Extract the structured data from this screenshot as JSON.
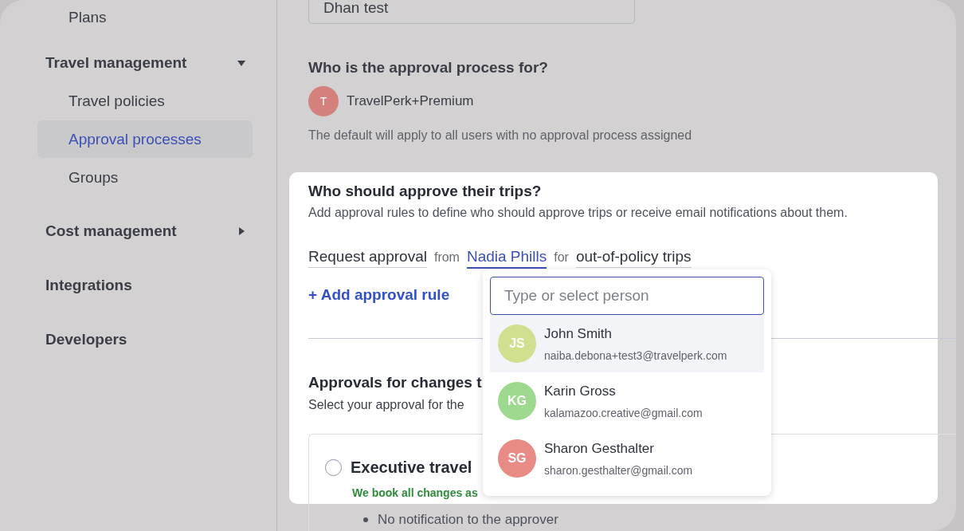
{
  "sidebar": {
    "loose_items": [
      {
        "label": "Plans",
        "selected": false
      }
    ],
    "groups": [
      {
        "label": "Travel management",
        "expanded": true,
        "children": [
          {
            "label": "Travel policies",
            "selected": false
          },
          {
            "label": "Approval processes",
            "selected": true
          },
          {
            "label": "Groups",
            "selected": false
          }
        ]
      },
      {
        "label": "Cost management",
        "expanded": false
      },
      {
        "label": "Integrations"
      },
      {
        "label": "Developers"
      }
    ]
  },
  "name_field": {
    "value": "Dhan test"
  },
  "audience": {
    "title": "Who is the approval process for?",
    "member": {
      "initial": "T",
      "name": "TravelPerk+Premium",
      "color": "#d4807c"
    },
    "note": "The default will apply to all users with no approval process assigned"
  },
  "approvers": {
    "title": "Who should approve their trips?",
    "description": "Add approval rules to define who should approve trips or receive email notifications about them.",
    "rule": [
      {
        "kind": "select",
        "text": "Request approval",
        "selected": false
      },
      {
        "kind": "word",
        "text": "from"
      },
      {
        "kind": "select",
        "text": "Nadia Phills",
        "selected": true
      },
      {
        "kind": "word",
        "text": "for"
      },
      {
        "kind": "select",
        "text": "out-of-policy trips",
        "selected": false
      }
    ],
    "add_link": "+ Add approval rule"
  },
  "changes": {
    "title": "Approvals for changes t",
    "description": "Select your approval for the",
    "option": {
      "label": "Executive travel",
      "checked": false,
      "tagline": "We book all changes as",
      "bullet": "No notification to the approver"
    }
  },
  "person_dropdown": {
    "placeholder": "Type or select person",
    "options": [
      {
        "initials": "JS",
        "name": "John Smith",
        "email": "naiba.debona+test3@travelperk.com",
        "color": "#cfe08f",
        "selected": true
      },
      {
        "initials": "KG",
        "name": "Karin Gross",
        "email": "kalamazoo.creative@gmail.com",
        "color": "#9dd98e",
        "selected": false
      },
      {
        "initials": "SG",
        "name": "Sharon Gesthalter",
        "email": "sharon.gesthalter@gmail.com",
        "color": "#e88b84",
        "selected": false
      }
    ]
  }
}
